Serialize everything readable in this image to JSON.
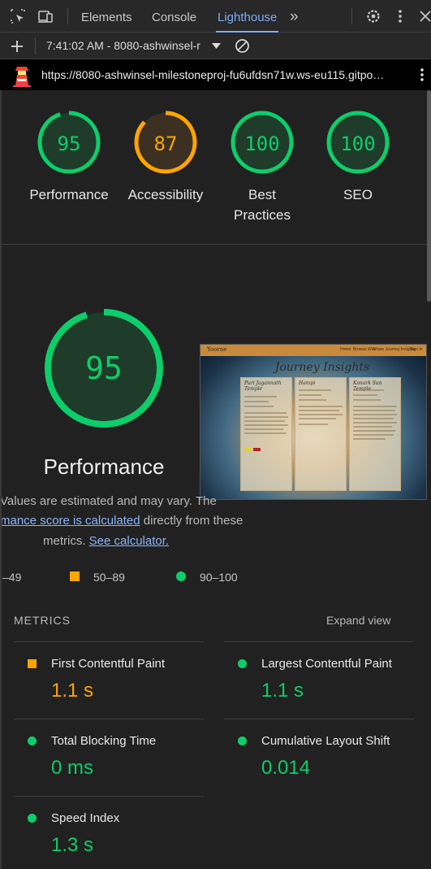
{
  "devtools": {
    "tabs": [
      {
        "label": "Elements",
        "active": false
      },
      {
        "label": "Console",
        "active": false
      },
      {
        "label": "Lighthouse",
        "active": true
      }
    ],
    "more_tabs_glyph": "»",
    "report_selector": "7:41:02 AM - 8080-ashwinsel-r",
    "url": "https://8080-ashwinsel-milestoneproj-fu6ufdsn71w.ws-eu115.gitpo…",
    "icons": [
      "inspect-element-icon",
      "device-toolbar-icon",
      "more-tabs-icon",
      "settings-icon",
      "kebab-menu-icon",
      "close-icon",
      "add-icon",
      "dropdown-icon",
      "clear-icon",
      "lighthouse-logo",
      "url-menu-icon"
    ]
  },
  "summary": {
    "gauges": [
      {
        "score": "95",
        "label": "Performance",
        "color": "#0cce6b",
        "fraction": 0.95
      },
      {
        "score": "87",
        "label": "Accessibility",
        "color": "#ffa400",
        "fraction": 0.87
      },
      {
        "score": "100",
        "label_line1": "Best",
        "label_line2": "Practices",
        "color": "#0cce6b",
        "fraction": 1.0
      },
      {
        "score": "100",
        "label": "SEO",
        "color": "#0cce6b",
        "fraction": 1.0
      }
    ]
  },
  "performance": {
    "score": "95",
    "fraction": 0.95,
    "title": "Performance",
    "desc_line1": "Values are estimated and may vary. The",
    "desc_link1": "mance score is calculated",
    "desc_line2_rest": "directly from these",
    "desc_line3_prefix": "metrics.",
    "desc_link2": "See calculator.",
    "legend": [
      "–49",
      "50–89",
      "90–100"
    ]
  },
  "screenshot": {
    "logo": "Yoorne",
    "nav_links": [
      "Home",
      "Browse Wiki",
      "Share Journey Insights",
      "Sign In"
    ],
    "heading": "Journey Insights",
    "cards": [
      "Puri Jagannath Temple",
      "Hampi",
      "Konark Sun Temple"
    ]
  },
  "metrics": {
    "title": "METRICS",
    "expand_label": "Expand view",
    "items": [
      {
        "label": "First Contentful Paint",
        "value": "1.1 s",
        "status": "average",
        "color": "#ffa400"
      },
      {
        "label": "Largest Contentful Paint",
        "value": "1.1 s",
        "status": "pass",
        "color": "#0cce6b"
      },
      {
        "label": "Total Blocking Time",
        "value": "0 ms",
        "status": "pass",
        "color": "#0cce6b"
      },
      {
        "label": "Cumulative Layout Shift",
        "value": "0.014",
        "status": "pass",
        "color": "#0cce6b"
      },
      {
        "label": "Speed Index",
        "value": "1.3 s",
        "status": "pass",
        "color": "#0cce6b"
      }
    ]
  }
}
